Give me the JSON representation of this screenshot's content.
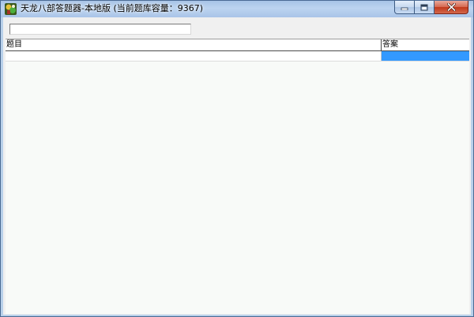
{
  "window": {
    "title": "天龙八部答题器-本地版 (当前题库容量：9367)",
    "icon": "app-icon"
  },
  "caption_buttons": {
    "minimize_icon": "minimize-icon",
    "maximize_icon": "maximize-icon",
    "close_icon": "close-icon"
  },
  "search": {
    "value": "",
    "placeholder": ""
  },
  "grid": {
    "columns": [
      "题目",
      "答案"
    ],
    "rows": [
      {
        "question": "",
        "answer": "",
        "answer_selected": true
      }
    ],
    "selection_color": "#3399ff"
  },
  "colors": {
    "titlebar": "#b9d1ea",
    "client_background": "#f0f0f0",
    "grid_background": "#f8faf8",
    "close_button": "#c7503a"
  }
}
